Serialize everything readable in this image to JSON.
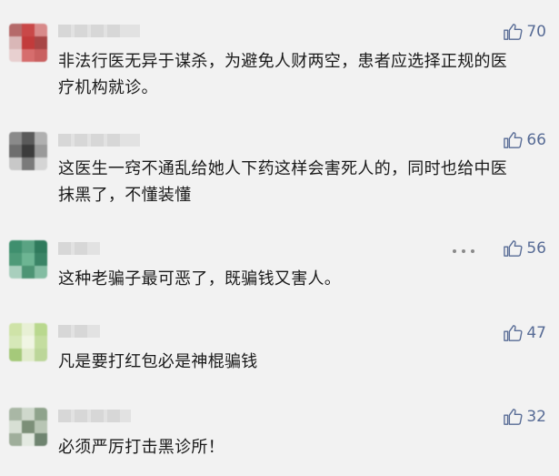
{
  "comments": [
    {
      "text": "非法行医无异于谋杀，为避免人财两空，患者应选择正规的医疗机构就诊。",
      "likes": "70"
    },
    {
      "text": "这医生一窍不通乱给她人下药这样会害死人的，同时也给中医抹黑了，不懂装懂",
      "likes": "66"
    },
    {
      "text": "这种老骗子最可恶了，既骗钱又害人。",
      "likes": "56"
    },
    {
      "text": "凡是要打红包必是神棍骗钱",
      "likes": "47"
    },
    {
      "text": "必须严厉打击黑诊所！",
      "likes": "32"
    }
  ],
  "icons": {
    "like": "thumbs-up-icon",
    "more": "more-dots-icon"
  },
  "colors": {
    "background": "#f2f2f2",
    "like_count": "#576b95",
    "text": "#1a1a1a"
  }
}
